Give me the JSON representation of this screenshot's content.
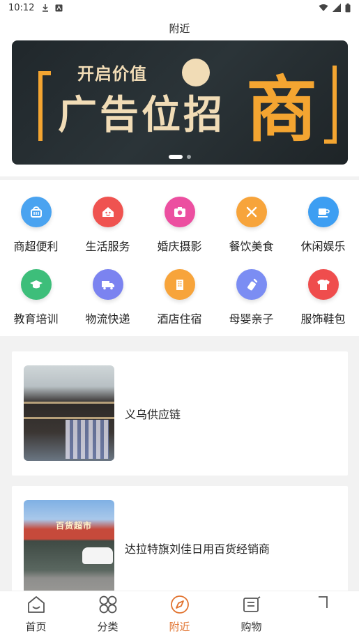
{
  "status_bar": {
    "time": "10:12"
  },
  "nav": {
    "title": "附近"
  },
  "banner": {
    "subtitle": "开启价值",
    "main_text": "广告位招",
    "big_text": "商",
    "active_slide": 1,
    "slide_count": 2
  },
  "categories": [
    {
      "label": "商超便利",
      "icon": "basket-icon",
      "color": "#4aa3f0"
    },
    {
      "label": "生活服务",
      "icon": "house-icon",
      "color": "#ef5350"
    },
    {
      "label": "婚庆摄影",
      "icon": "camera-icon",
      "color": "#ec4fa0"
    },
    {
      "label": "餐饮美食",
      "icon": "fork-knife-icon",
      "color": "#f7a43b"
    },
    {
      "label": "休闲娱乐",
      "icon": "coffee-icon",
      "color": "#3d9ef2"
    },
    {
      "label": "教育培训",
      "icon": "graduation-cap-icon",
      "color": "#3dbe7a"
    },
    {
      "label": "物流快递",
      "icon": "truck-icon",
      "color": "#7b83f0"
    },
    {
      "label": "酒店住宿",
      "icon": "building-icon",
      "color": "#f7a43b"
    },
    {
      "label": "母婴亲子",
      "icon": "baby-bottle-icon",
      "color": "#7b8df3"
    },
    {
      "label": "服饰鞋包",
      "icon": "shirt-icon",
      "color": "#ef4d4d"
    }
  ],
  "stores": [
    {
      "name": "义乌供应链"
    },
    {
      "name": "达拉特旗刘佳日用百货经销商",
      "sign": "百货超市"
    }
  ],
  "tabs": [
    {
      "label": "首页",
      "icon": "home-icon",
      "active": false
    },
    {
      "label": "分类",
      "icon": "grid-icon",
      "active": false
    },
    {
      "label": "附近",
      "icon": "compass-icon",
      "active": true
    },
    {
      "label": "购物",
      "icon": "cart-icon",
      "active": false
    },
    {
      "label": "",
      "icon": "user-icon",
      "active": false
    }
  ],
  "colors": {
    "accent": "#e1732f",
    "banner_gold": "#f4a531"
  }
}
